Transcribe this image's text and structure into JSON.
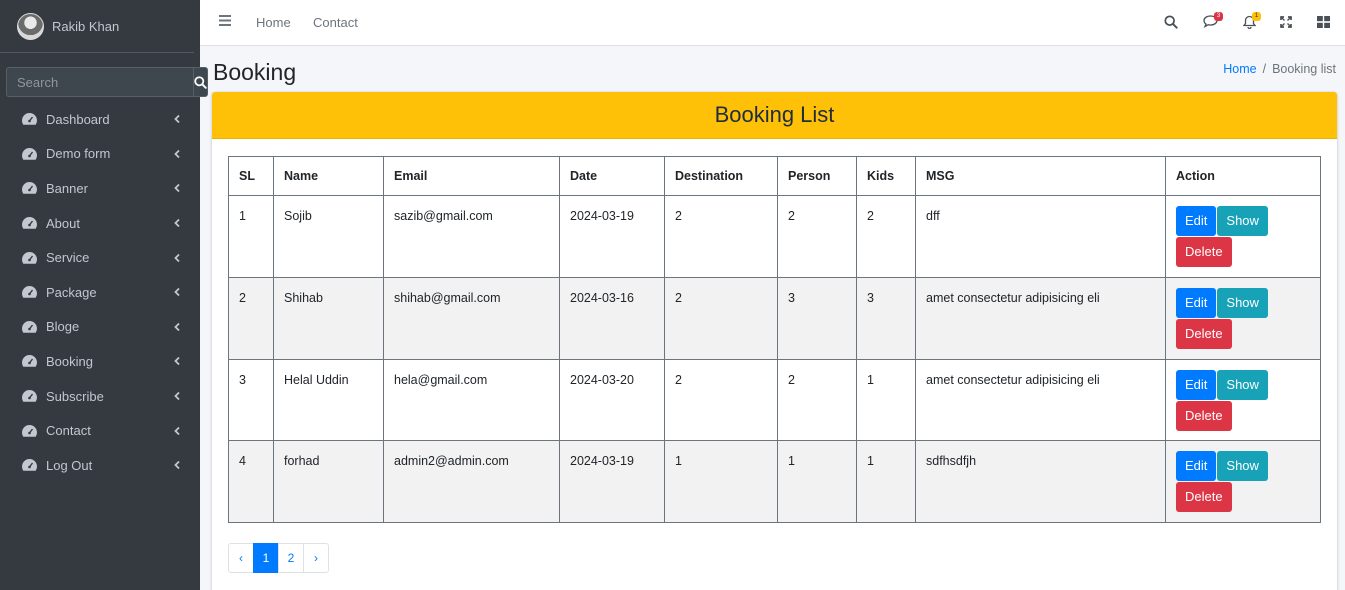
{
  "user": {
    "name": "Rakib Khan"
  },
  "search": {
    "placeholder": "Search"
  },
  "sidebar": {
    "items": [
      {
        "label": "Dashboard"
      },
      {
        "label": "Demo form"
      },
      {
        "label": "Banner"
      },
      {
        "label": "About"
      },
      {
        "label": "Service"
      },
      {
        "label": "Package"
      },
      {
        "label": "Bloge"
      },
      {
        "label": "Booking"
      },
      {
        "label": "Subscribe"
      },
      {
        "label": "Contact"
      },
      {
        "label": "Log Out"
      }
    ]
  },
  "topbar": {
    "home": "Home",
    "contact": "Contact",
    "messages_badge": "3",
    "notifications_badge": "1"
  },
  "page": {
    "title": "Booking"
  },
  "breadcrumb": {
    "home": "Home",
    "separator": "/",
    "current": "Booking list"
  },
  "card": {
    "title": "Booking List"
  },
  "table": {
    "headers": [
      "SL",
      "Name",
      "Email",
      "Date",
      "Destination",
      "Person",
      "Kids",
      "MSG",
      "Action"
    ],
    "rows": [
      [
        "1",
        "Sojib",
        "sazib@gmail.com",
        "2024-03-19",
        "2",
        "2",
        "2",
        "dff"
      ],
      [
        "2",
        "Shihab",
        "shihab@gmail.com",
        "2024-03-16",
        "2",
        "3",
        "3",
        "amet consectetur adipisicing eli"
      ],
      [
        "3",
        "Helal Uddin",
        "hela@gmail.com",
        "2024-03-20",
        "2",
        "2",
        "1",
        "amet consectetur adipisicing eli"
      ],
      [
        "4",
        "forhad",
        "admin2@admin.com",
        "2024-03-19",
        "1",
        "1",
        "1",
        "sdfhsdfjh"
      ]
    ],
    "actions": {
      "edit": "Edit",
      "show": "Show",
      "delete": "Delete"
    }
  },
  "pagination": {
    "prev": "‹",
    "pages": [
      "1",
      "2"
    ],
    "next": "›",
    "active": "1"
  },
  "colors": {
    "sidebar": "#343a40",
    "header": "#ffc107",
    "primary": "#007bff",
    "info": "#17a2b8",
    "danger": "#dc3545"
  }
}
